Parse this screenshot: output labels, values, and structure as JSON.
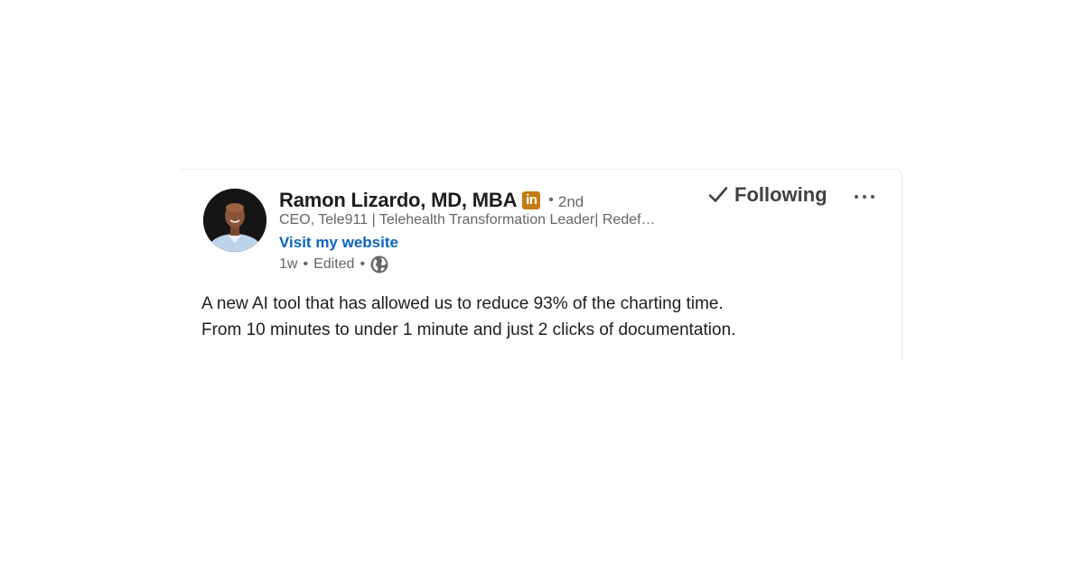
{
  "post": {
    "author": {
      "name": "Ramon Lizardo, MD, MBA",
      "premium_badge": "in",
      "badge_color": "#c37d16",
      "connection_separator": "•",
      "connection_degree": "2nd",
      "headline": "CEO, Tele911 | Telehealth Transformation Leader| Redef…",
      "website_link": "Visit my website",
      "link_color": "#0a66c2"
    },
    "meta": {
      "age": "1w",
      "separator": "•",
      "edited": "Edited",
      "visibility_icon": "globe-icon"
    },
    "actions": {
      "follow_icon": "check-icon",
      "follow_label": "Following",
      "more_icon": "more-horizontal-icon"
    },
    "body": {
      "line1": "A new AI tool that has allowed us to reduce 93% of the charting time.",
      "line2": "From 10 minutes to under 1 minute and just 2 clicks of documentation."
    }
  }
}
